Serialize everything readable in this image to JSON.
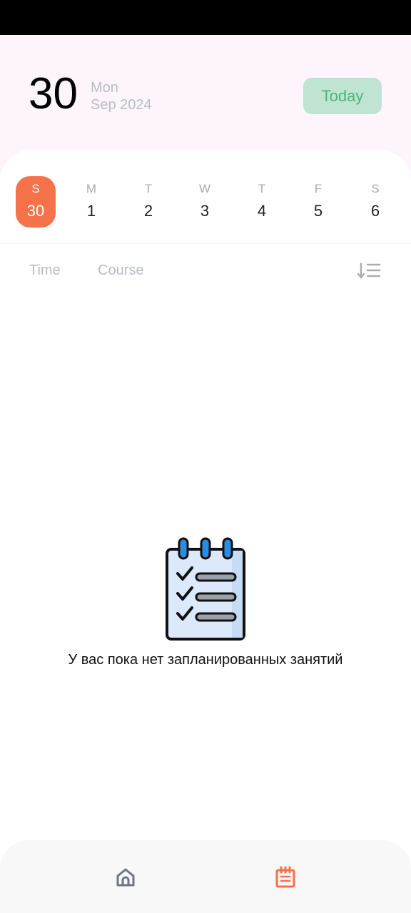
{
  "header": {
    "day_number": "30",
    "weekday": "Mon",
    "month_year": "Sep 2024",
    "today_label": "Today"
  },
  "week": [
    {
      "letter": "S",
      "num": "30",
      "selected": true
    },
    {
      "letter": "M",
      "num": "1",
      "selected": false
    },
    {
      "letter": "T",
      "num": "2",
      "selected": false
    },
    {
      "letter": "W",
      "num": "3",
      "selected": false
    },
    {
      "letter": "T",
      "num": "4",
      "selected": false
    },
    {
      "letter": "F",
      "num": "5",
      "selected": false
    },
    {
      "letter": "S",
      "num": "6",
      "selected": false
    }
  ],
  "tabs": {
    "time": "Time",
    "course": "Course"
  },
  "empty_state": {
    "message": "У вас пока нет запланированных занятий",
    "icon": "checklist-notepad-icon"
  },
  "bottom_nav": {
    "home_icon": "home-icon",
    "schedule_icon": "calendar-notepad-icon"
  },
  "colors": {
    "accent": "#f5724a",
    "today_bg": "#bfe4d2",
    "today_text": "#4ab57b",
    "header_bg": "#fdf5fb"
  }
}
